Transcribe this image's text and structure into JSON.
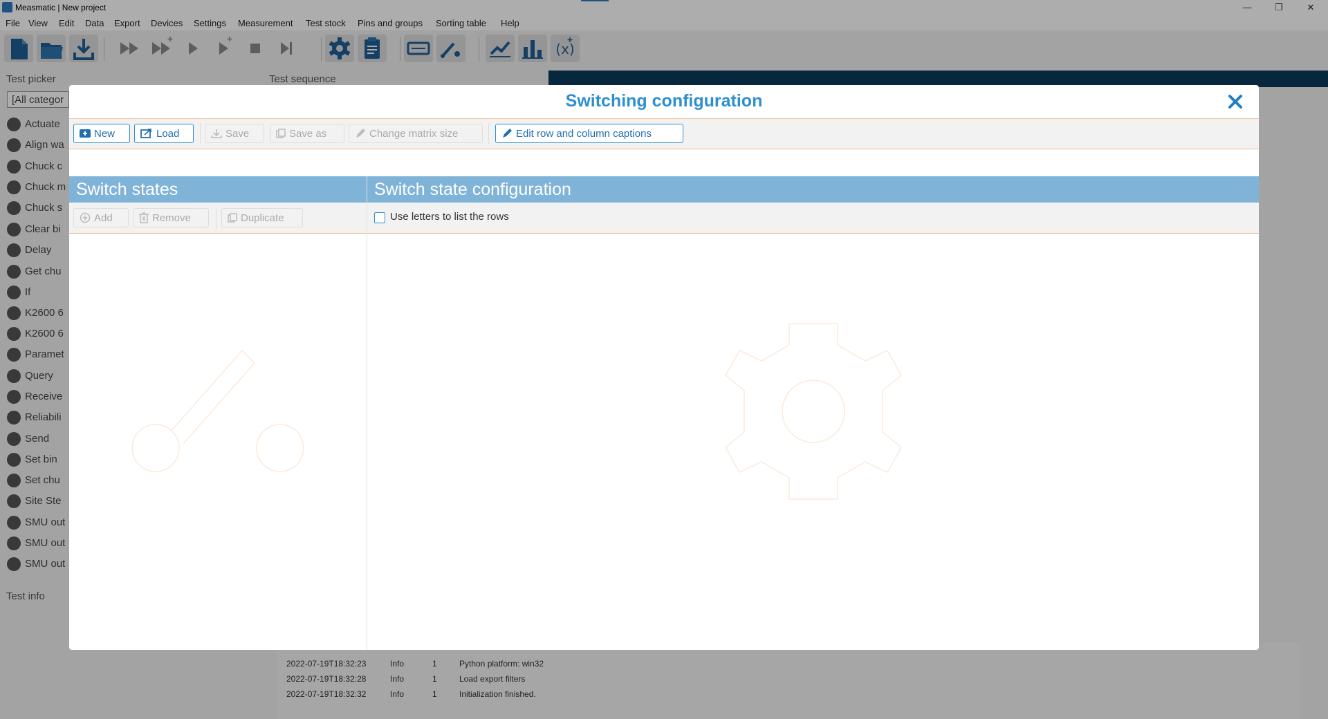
{
  "window": {
    "title": "Measmatic | New project",
    "controls": [
      "—",
      "❐",
      "✕"
    ]
  },
  "menu": [
    "File",
    "View",
    "Edit",
    "Data",
    "Export",
    "Devices",
    "Settings",
    "Measurement",
    "Test stock",
    "Pins and groups",
    "Sorting table",
    "Help"
  ],
  "toolbar_icons": [
    "new-file-icon",
    "open-folder-icon",
    "download-icon",
    "fast-forward-icon",
    "fast-forward-add-icon",
    "play-icon",
    "play-add-icon",
    "stop-icon",
    "skip-end-icon",
    "gear-icon",
    "clipboard-icon",
    "card-icon",
    "tool-icon",
    "line-chart-icon",
    "bar-chart-icon",
    "variable-icon"
  ],
  "background": {
    "test_picker_label": "Test picker",
    "test_sequence_label": "Test sequence",
    "category_filter": "[All categor",
    "test_info_label": "Test info",
    "left_items": [
      "Actuate",
      "Align wa",
      "Chuck c",
      "Chuck m",
      "Chuck s",
      "Clear bi",
      "Delay",
      "Get chu",
      "If",
      "K2600 6",
      "K2600 6",
      "Paramet",
      "Query",
      "Receive",
      "Reliabili",
      "Send",
      "Set bin",
      "Set chu",
      "Site Ste",
      "SMU out",
      "SMU out",
      "SMU out"
    ],
    "log_rows": [
      {
        "time": "2022-07-19T18:32:23",
        "level": "Info",
        "count": "1",
        "message": "Python platform: win32"
      },
      {
        "time": "2022-07-19T18:32:28",
        "level": "Info",
        "count": "1",
        "message": "Load export filters"
      },
      {
        "time": "2022-07-19T18:32:32",
        "level": "Info",
        "count": "1",
        "message": "Initialization finished."
      }
    ]
  },
  "dialog": {
    "title": "Switching configuration",
    "toolbar": {
      "new": "New",
      "load": "Load",
      "save": "Save",
      "save_as": "Save as",
      "change_matrix_size": "Change matrix size",
      "edit_captions": "Edit row and column captions"
    },
    "switch_states": {
      "header": "Switch states",
      "add": "Add",
      "remove": "Remove",
      "duplicate": "Duplicate"
    },
    "config": {
      "header": "Switch state configuration",
      "use_letters_label": "Use letters to list the rows",
      "use_letters_checked": false
    }
  },
  "colors": {
    "accent": "#2e8fcf",
    "section_header": "#7fb3d8",
    "orange_line": "#f0b98a",
    "dark_bar": "#0b3a5e"
  }
}
